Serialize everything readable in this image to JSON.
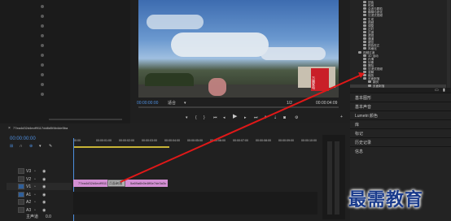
{
  "program_monitor": {
    "timecode_in": "00:00:00:00",
    "fit_label": "适合",
    "quality_label": "1/2",
    "timecode_out": "00:00:04:09",
    "shop_sign_text": "万顺家电"
  },
  "effects_panel": {
    "tree": [
      {
        "label": "扭曲",
        "level": 1
      },
      {
        "label": "时间",
        "level": 1
      },
      {
        "label": "杂波与颗粒",
        "level": 1
      },
      {
        "label": "模糊与锐化",
        "level": 1
      },
      {
        "label": "沉浸式视频",
        "level": 1
      },
      {
        "label": "生成",
        "level": 1
      },
      {
        "label": "视频",
        "level": 1
      },
      {
        "label": "调整",
        "level": 1
      },
      {
        "label": "过时",
        "level": 1
      },
      {
        "label": "过渡",
        "level": 1
      },
      {
        "label": "透视",
        "level": 1
      },
      {
        "label": "通道",
        "level": 1
      },
      {
        "label": "键控",
        "level": 1
      },
      {
        "label": "颜色校正",
        "level": 1
      },
      {
        "label": "风格化",
        "level": 1
      },
      {
        "label": "视频过渡",
        "level": 0
      },
      {
        "label": "3D 运动",
        "level": 1
      },
      {
        "label": "内滑",
        "level": 1
      },
      {
        "label": "划像",
        "level": 1
      },
      {
        "label": "擦除",
        "level": 1
      },
      {
        "label": "沉浸式视频",
        "level": 1
      },
      {
        "label": "溶解",
        "level": 1
      },
      {
        "label": "缩放",
        "level": 1
      },
      {
        "label": "页面剥落",
        "level": 1
      },
      {
        "label": "翻页",
        "level": 2
      },
      {
        "label": "页面剥落",
        "level": 2,
        "selected": true
      }
    ],
    "sections": [
      "基本图形",
      "基本声音",
      "Lumetri 颜色",
      "库",
      "标记",
      "历史记录",
      "信息"
    ]
  },
  "sequence": {
    "tab_name": "77ea4d32d4ecff9117dd8d5f4b4de5ba",
    "timecode": "00:00:00:00",
    "ruler": [
      "00:00",
      "00:00:01:00",
      "00:00:02:00",
      "00:00:03:00",
      "00:00:04:00",
      "00:00:05:00",
      "00:00:06:00",
      "00:00:07:00",
      "00:00:08:00",
      "00:00:09:00",
      "00:00:10:00"
    ],
    "tracks": [
      {
        "name": "V3"
      },
      {
        "name": "V2"
      },
      {
        "name": "V1"
      },
      {
        "name": "A1"
      },
      {
        "name": "A2"
      },
      {
        "name": "A3"
      }
    ],
    "clip_a": "77ea4d32d4ecff9117dd8d5f",
    "transition": "页面剥落",
    "clip_b": "5a69a6b0e4ff6e7de3a3c",
    "master_label": "主声道",
    "master_value": "0.0"
  },
  "watermark": "最需教育",
  "colors": {
    "accent": "#4d8fe0",
    "clip": "#d48fd4",
    "arrow": "#e01818"
  }
}
